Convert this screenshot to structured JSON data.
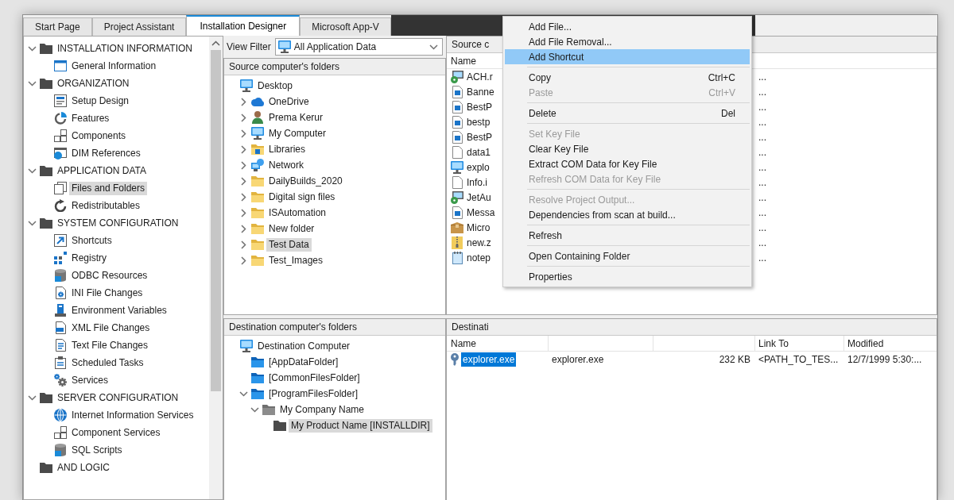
{
  "tabs": [
    {
      "label": "Start Page",
      "selected": false
    },
    {
      "label": "Project Assistant",
      "selected": false
    },
    {
      "label": "Installation Designer",
      "selected": true
    },
    {
      "label": "Microsoft App-V",
      "selected": false
    }
  ],
  "sidebar": {
    "tree": [
      {
        "label": "INSTALLATION INFORMATION",
        "expanded": true,
        "selected": false,
        "children": [
          {
            "label": "General Information",
            "selected": false
          }
        ]
      },
      {
        "label": "ORGANIZATION",
        "expanded": true,
        "selected": false,
        "children": [
          {
            "label": "Setup Design",
            "selected": false
          },
          {
            "label": "Features",
            "selected": false
          },
          {
            "label": "Components",
            "selected": false
          },
          {
            "label": "DIM References",
            "selected": false
          }
        ]
      },
      {
        "label": "APPLICATION DATA",
        "expanded": true,
        "selected": false,
        "children": [
          {
            "label": "Files and Folders",
            "selected": true
          },
          {
            "label": "Redistributables",
            "selected": false
          }
        ]
      },
      {
        "label": "SYSTEM CONFIGURATION",
        "expanded": true,
        "selected": false,
        "children": [
          {
            "label": "Shortcuts",
            "selected": false
          },
          {
            "label": "Registry",
            "selected": false
          },
          {
            "label": "ODBC Resources",
            "selected": false
          },
          {
            "label": "INI File Changes",
            "selected": false
          },
          {
            "label": "Environment Variables",
            "selected": false
          },
          {
            "label": "XML File Changes",
            "selected": false
          },
          {
            "label": "Text File Changes",
            "selected": false
          },
          {
            "label": "Scheduled Tasks",
            "selected": false
          },
          {
            "label": "Services",
            "selected": false
          }
        ]
      },
      {
        "label": "SERVER CONFIGURATION",
        "expanded": true,
        "selected": false,
        "children": [
          {
            "label": "Internet Information Services",
            "selected": false
          },
          {
            "label": "Component Services",
            "selected": false
          },
          {
            "label": "SQL Scripts",
            "selected": false
          }
        ]
      },
      {
        "label": "AND LOGIC",
        "selected": false
      }
    ]
  },
  "folders": {
    "view_filter": {
      "label": "View Filter",
      "value": "All Application Data"
    },
    "source": {
      "caption": "Source computer's folders",
      "tree": [
        {
          "label": "Desktop",
          "selected": false,
          "children": [
            {
              "label": "OneDrive",
              "expanded": false,
              "selected": false
            },
            {
              "label": "Prema Kerur",
              "expanded": false,
              "selected": false
            },
            {
              "label": "My Computer",
              "expanded": false,
              "selected": false
            },
            {
              "label": "Libraries",
              "expanded": false,
              "selected": false
            },
            {
              "label": "Network",
              "expanded": false,
              "selected": false
            },
            {
              "label": "DailyBuilds_2020",
              "expanded": false,
              "selected": false
            },
            {
              "label": "Digital sign files",
              "expanded": false,
              "selected": false
            },
            {
              "label": "ISAutomation",
              "expanded": false,
              "selected": false
            },
            {
              "label": "New folder",
              "expanded": false,
              "selected": false
            },
            {
              "label": "Test Data",
              "expanded": false,
              "selected": true
            },
            {
              "label": "Test_Images",
              "expanded": false,
              "selected": false
            }
          ]
        }
      ]
    },
    "destination": {
      "caption": "Destination computer's folders",
      "tree": [
        {
          "label": "Destination Computer",
          "selected": false,
          "children": [
            {
              "label": "[AppDataFolder]",
              "selected": false
            },
            {
              "label": "[CommonFilesFolder]",
              "selected": false
            },
            {
              "label": "[ProgramFilesFolder]",
              "expanded": true,
              "selected": false,
              "children": [
                {
                  "label": "My Company Name",
                  "expanded": true,
                  "selected": false,
                  "children": [
                    {
                      "label": "My Product Name [INSTALLDIR]",
                      "selected": true
                    }
                  ]
                }
              ]
            }
          ]
        }
      ]
    }
  },
  "files": {
    "source": {
      "caption": "Source c",
      "columns": [
        "Name"
      ],
      "rows": [
        {
          "name": "ACH.r",
          "column_2": "..."
        },
        {
          "name": "Banne",
          "column_2": "..."
        },
        {
          "name": "BestP",
          "column_2": "..."
        },
        {
          "name": "bestp",
          "column_2": "..."
        },
        {
          "name": "BestP",
          "column_2": "..."
        },
        {
          "name": "data1",
          "column_2": "..."
        },
        {
          "name": "explo",
          "column_2": "..."
        },
        {
          "name": "Info.i",
          "column_2": "..."
        },
        {
          "name": "JetAu",
          "column_2": "..."
        },
        {
          "name": "Messa",
          "column_2": "..."
        },
        {
          "name": "Micro",
          "column_2": "..."
        },
        {
          "name": "new.z",
          "column_2": "..."
        },
        {
          "name": "notep",
          "column_2": "..."
        }
      ]
    },
    "destination": {
      "caption": "Destinati",
      "columns": [
        "Name",
        "Link To",
        "Modified"
      ],
      "rows": [
        {
          "name": "explorer.exe",
          "selected": true,
          "column_2": "explorer.exe",
          "column_3": "232 KB",
          "link_to": "<PATH_TO_TES...",
          "modified": "12/7/1999 5:30:..."
        }
      ]
    }
  },
  "context_menu": {
    "items": [
      {
        "kind": "item",
        "label": "Add File...",
        "disabled": false,
        "selected": false
      },
      {
        "kind": "item",
        "label": "Add File Removal...",
        "disabled": false,
        "selected": false
      },
      {
        "kind": "item",
        "label": "Add Shortcut",
        "disabled": false,
        "selected": true
      },
      {
        "kind": "separator"
      },
      {
        "kind": "item",
        "label": "Copy",
        "shortcut": "Ctrl+C",
        "disabled": false,
        "selected": false
      },
      {
        "kind": "item",
        "label": "Paste",
        "shortcut": "Ctrl+V",
        "disabled": true,
        "selected": false
      },
      {
        "kind": "separator"
      },
      {
        "kind": "item",
        "label": "Delete",
        "shortcut": "Del",
        "disabled": false,
        "selected": false
      },
      {
        "kind": "separator"
      },
      {
        "kind": "item",
        "label": "Set Key File",
        "disabled": true,
        "selected": false
      },
      {
        "kind": "item",
        "label": "Clear Key File",
        "disabled": false,
        "selected": false
      },
      {
        "kind": "item",
        "label": "Extract COM Data for Key File",
        "disabled": false,
        "selected": false
      },
      {
        "kind": "item",
        "label": "Refresh COM Data for Key File",
        "disabled": true,
        "selected": false
      },
      {
        "kind": "separator"
      },
      {
        "kind": "item",
        "label": "Resolve Project Output...",
        "disabled": true,
        "selected": false
      },
      {
        "kind": "item",
        "label": "Dependencies from scan at build...",
        "disabled": false,
        "selected": false
      },
      {
        "kind": "separator"
      },
      {
        "kind": "item",
        "label": "Refresh",
        "disabled": false,
        "selected": false
      },
      {
        "kind": "separator"
      },
      {
        "kind": "item",
        "label": "Open Containing Folder",
        "disabled": false,
        "selected": false
      },
      {
        "kind": "separator"
      },
      {
        "kind": "item",
        "label": "Properties",
        "disabled": false,
        "selected": false
      }
    ]
  }
}
